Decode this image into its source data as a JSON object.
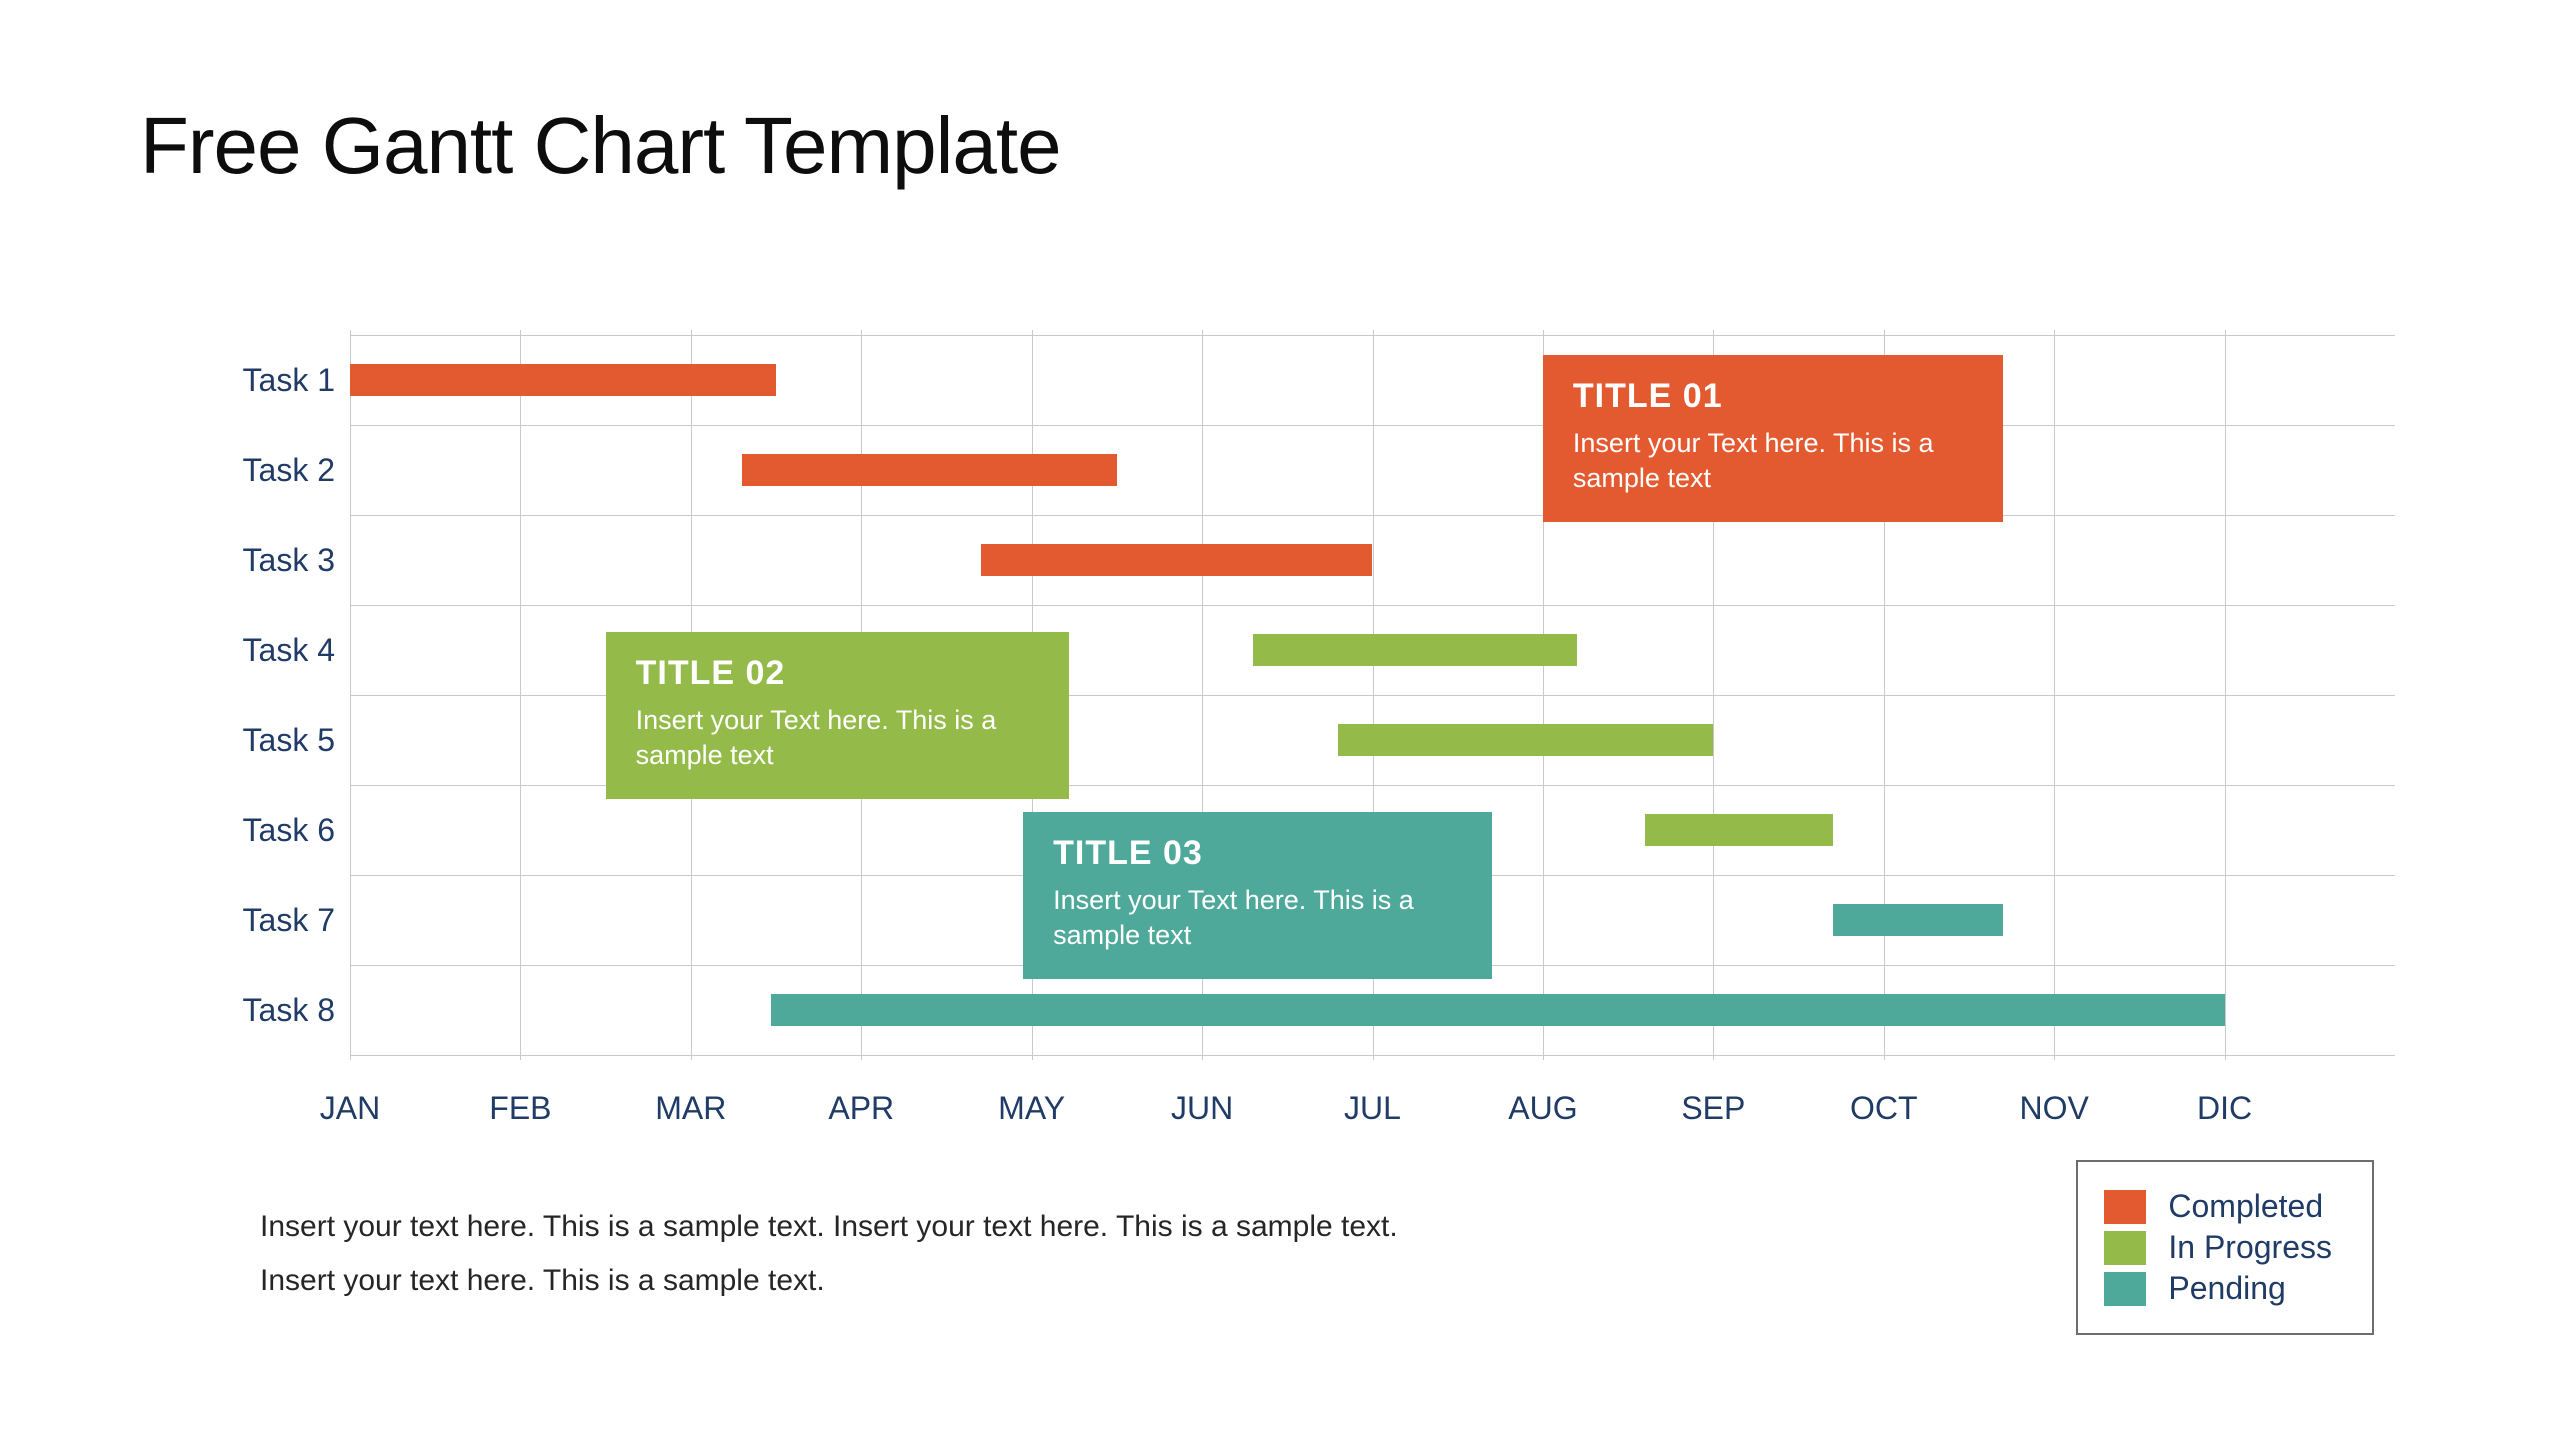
{
  "title": "Free Gantt Chart Template",
  "chart_data": {
    "type": "gantt",
    "months": [
      "JAN",
      "FEB",
      "MAR",
      "APR",
      "MAY",
      "JUN",
      "JUL",
      "AUG",
      "SEP",
      "OCT",
      "NOV",
      "DIC"
    ],
    "xlabel": "",
    "ylabel": "",
    "tasks": [
      {
        "name": "Task 1",
        "start": 0.0,
        "end": 2.5,
        "status": "completed"
      },
      {
        "name": "Task 2",
        "start": 2.3,
        "end": 4.5,
        "status": "completed"
      },
      {
        "name": "Task 3",
        "start": 3.7,
        "end": 6.0,
        "status": "completed"
      },
      {
        "name": "Task 4",
        "start": 5.3,
        "end": 7.2,
        "status": "progress"
      },
      {
        "name": "Task 5",
        "start": 5.8,
        "end": 8.0,
        "status": "progress"
      },
      {
        "name": "Task 6",
        "start": 7.6,
        "end": 8.7,
        "status": "progress"
      },
      {
        "name": "Task 7",
        "start": 8.7,
        "end": 9.7,
        "status": "pending"
      },
      {
        "name": "Task 8",
        "start": 2.47,
        "end": 11.0,
        "status": "pending"
      }
    ],
    "callouts": [
      {
        "id": "01",
        "title": "TITLE 01",
        "body": "Insert your Text here. This is a sample text",
        "status": "completed",
        "x": 7.0,
        "y": 0.28,
        "h": 1.6,
        "w": 2.7
      },
      {
        "id": "02",
        "title": "TITLE 02",
        "body": "Insert your Text here. This is a sample text",
        "status": "progress",
        "x": 1.5,
        "y": 3.35,
        "h": 1.6,
        "w": 2.72
      },
      {
        "id": "03",
        "title": "TITLE 03",
        "body": "Insert your Text here. This is a sample text",
        "status": "pending",
        "x": 3.95,
        "y": 5.35,
        "h": 1.6,
        "w": 2.75
      }
    ],
    "legend": [
      {
        "label": "Completed",
        "status": "completed"
      },
      {
        "label": "In Progress",
        "status": "progress"
      },
      {
        "label": "Pending",
        "status": "pending"
      }
    ],
    "colors": {
      "completed": "#e35a31",
      "progress": "#94bb4a",
      "pending": "#4fa99a"
    }
  },
  "bottom_text_line1": "Insert your text here. This is a sample text. Insert your text here. This is a sample text.",
  "bottom_text_line2": "Insert your text here. This is a sample text."
}
